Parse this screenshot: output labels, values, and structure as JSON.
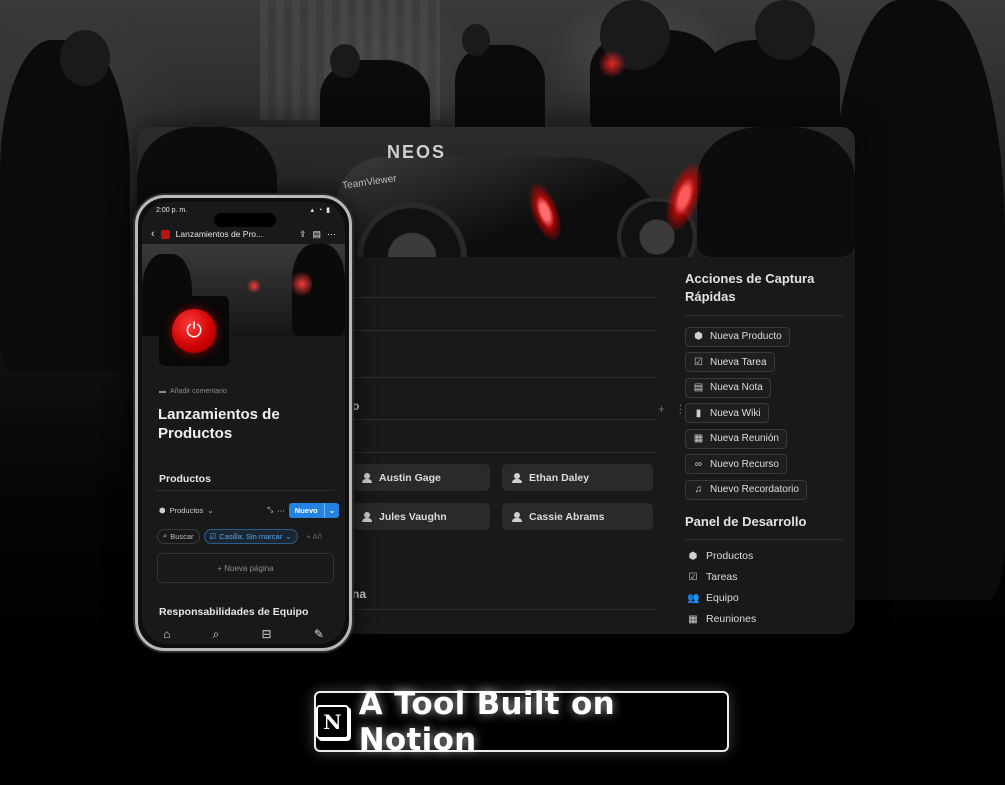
{
  "desktop": {
    "left_fragments": [
      "o",
      "na"
    ],
    "people": [
      "Austin Gage",
      "Ethan Daley",
      "Jules Vaughn",
      "Cassie Abrams"
    ],
    "quick_actions": {
      "heading": "Acciones de Captura Rápidas",
      "buttons": [
        {
          "label": "Nueva Producto",
          "icon": "cube-icon"
        },
        {
          "label": "Nueva Tarea",
          "icon": "checkbox-icon"
        },
        {
          "label": "Nueva Nota",
          "icon": "note-icon"
        },
        {
          "label": "Nueva Wiki",
          "icon": "bookmark-icon"
        },
        {
          "label": "Nueva Reunión",
          "icon": "calendar-icon"
        },
        {
          "label": "Nuevo Recurso",
          "icon": "link-icon"
        },
        {
          "label": "Nuevo Recordatorio",
          "icon": "bell-icon"
        }
      ]
    },
    "dev_panel": {
      "heading": "Panel de Desarrollo",
      "items": [
        {
          "label": "Productos",
          "icon": "cube-icon"
        },
        {
          "label": "Tareas",
          "icon": "checkbox-icon"
        },
        {
          "label": "Equipo",
          "icon": "people-icon"
        },
        {
          "label": "Reuniones",
          "icon": "calendar-icon"
        }
      ]
    }
  },
  "phone": {
    "status_time": "2:00 p. m.",
    "nav_title": "Lanzamientos de Pro...",
    "comment": "Añadir comentario",
    "page_title": "Lanzamientos de Productos",
    "section_products": "Productos",
    "view_label": "Productos",
    "new_button": "Nuevo",
    "filters": {
      "search": "Buscar",
      "checkbox_filter": "Casilla: Sin marcar",
      "add": "+ Añ"
    },
    "new_page": "+ Nueva página",
    "section_team": "Responsabilidades de Equipo"
  },
  "footer": {
    "logo_letter": "N",
    "tagline": "A Tool Built on Notion"
  }
}
